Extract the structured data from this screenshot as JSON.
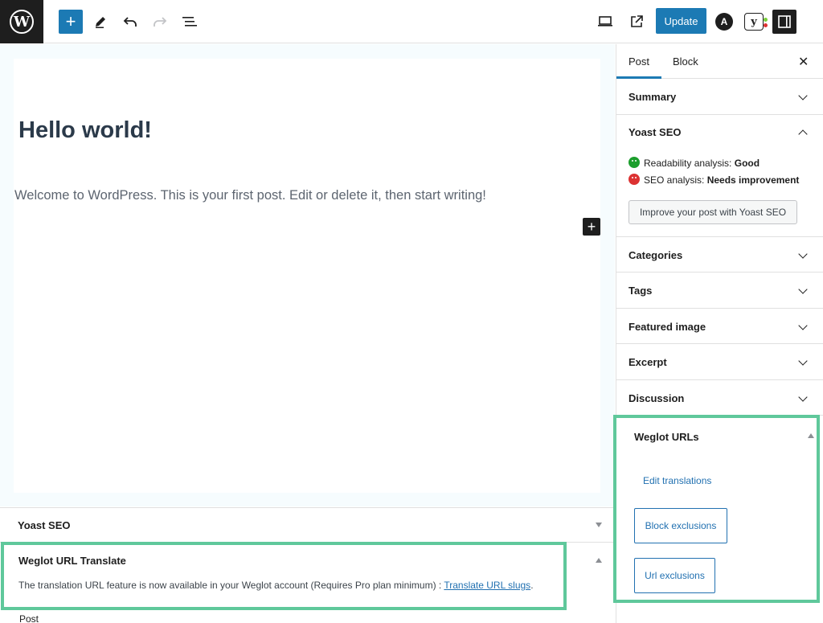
{
  "toolbar": {
    "logo_glyph": "W",
    "add_glyph": "+",
    "update_label": "Update",
    "astra_glyph": "A",
    "yoast_glyph": "y",
    "icons": [
      "pencil-icon",
      "undo-icon",
      "redo-icon",
      "list-view-icon",
      "desktop-preview-icon",
      "external-preview-icon"
    ]
  },
  "editor": {
    "title": "Hello world!",
    "paragraph": "Welcome to WordPress. This is your first post. Edit or delete it, then start writing!",
    "inline_add_glyph": "+"
  },
  "meta_boxes": {
    "yoast_title": "Yoast SEO",
    "weglot_title": "Weglot URL Translate",
    "weglot_message": "The translation URL feature is now available in your Weglot account (Requires Pro plan minimum) : ",
    "weglot_link": "Translate URL slugs",
    "weglot_suffix": "."
  },
  "footer": {
    "breadcrumb": "Post"
  },
  "sidebar": {
    "tabs": {
      "post": "Post",
      "block": "Block",
      "close": "✕"
    },
    "summary": "Summary",
    "yoast": {
      "title": "Yoast SEO",
      "readability_label": "Readability analysis: ",
      "readability_value": "Good",
      "seo_label": "SEO analysis: ",
      "seo_value": "Needs improvement",
      "improve_button": "Improve your post with Yoast SEO"
    },
    "categories": "Categories",
    "tags": "Tags",
    "featured_image": "Featured image",
    "excerpt": "Excerpt",
    "discussion": "Discussion",
    "weglot_urls": {
      "title": "Weglot URLs",
      "edit_translations": "Edit translations",
      "block_exclusions": "Block exclusions",
      "url_exclusions": "Url exclusions"
    }
  },
  "colors": {
    "accent": "#1c7ab4",
    "highlight": "#5fc89b",
    "good": "#1c9e2d",
    "bad": "#dc3232"
  }
}
